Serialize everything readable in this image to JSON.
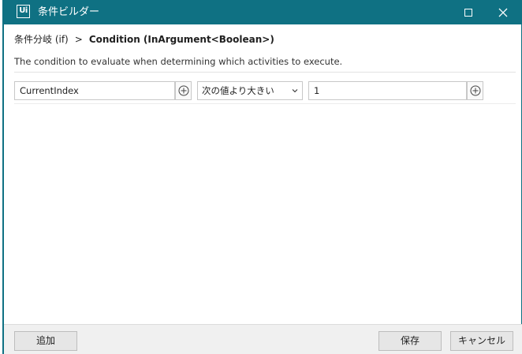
{
  "window": {
    "app_icon_text": "Ui",
    "title": "条件ビルダー"
  },
  "breadcrumb": {
    "parent": "条件分岐 (if)",
    "separator": ">",
    "current": "Condition (InArgument<Boolean>)"
  },
  "description": "The condition to evaluate when determining which activities to execute.",
  "condition": {
    "left_operand": "CurrentIndex",
    "operator": "次の値より大きい",
    "right_operand": "1"
  },
  "footer": {
    "add_label": "追加",
    "save_label": "保存",
    "cancel_label": "キャンセル"
  },
  "colors": {
    "titlebar": "#0f7183",
    "footer_bg": "#f0f0f0"
  },
  "icons": {
    "maximize": "maximize-icon",
    "close": "close-icon",
    "plus": "plus-circle-icon",
    "dropdown": "chevron-down-icon"
  }
}
